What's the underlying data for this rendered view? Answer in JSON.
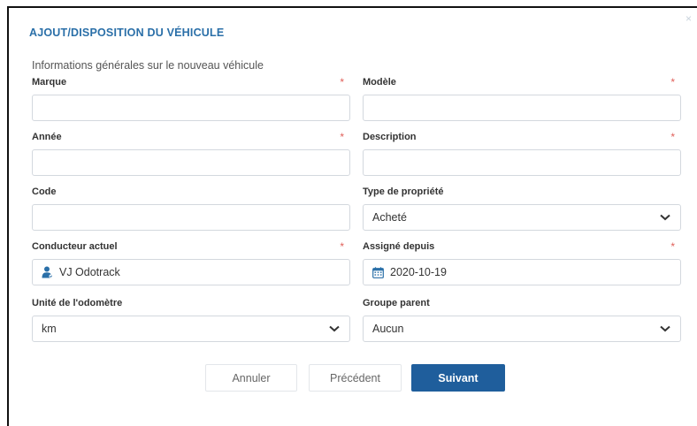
{
  "dialog": {
    "title": "AJOUT/DISPOSITION DU VÉHICULE",
    "close_glyph": "×",
    "section_heading": "Informations générales sur le nouveau véhicule"
  },
  "fields": {
    "marque": {
      "label": "Marque",
      "required": "*",
      "value": ""
    },
    "modele": {
      "label": "Modèle",
      "required": "*",
      "value": ""
    },
    "annee": {
      "label": "Année",
      "required": "*",
      "value": ""
    },
    "description": {
      "label": "Description",
      "required": "*",
      "value": ""
    },
    "code": {
      "label": "Code",
      "value": ""
    },
    "type_propriete": {
      "label": "Type de propriété",
      "value": "Acheté"
    },
    "conducteur": {
      "label": "Conducteur actuel",
      "required": "*",
      "value": "VJ Odotrack",
      "icon": "user-icon"
    },
    "assigne_depuis": {
      "label": "Assigné depuis",
      "required": "*",
      "value": "2020-10-19",
      "icon": "calendar-icon"
    },
    "odometre": {
      "label": "Unité de l'odomètre",
      "value": "km"
    },
    "groupe_parent": {
      "label": "Groupe parent",
      "value": "Aucun"
    }
  },
  "buttons": {
    "cancel": "Annuler",
    "previous": "Précédent",
    "next": "Suivant"
  },
  "colors": {
    "accent": "#2a6fa8",
    "primary_button": "#1f5e9c",
    "required": "#e0605a",
    "border": "#d3d8de"
  }
}
